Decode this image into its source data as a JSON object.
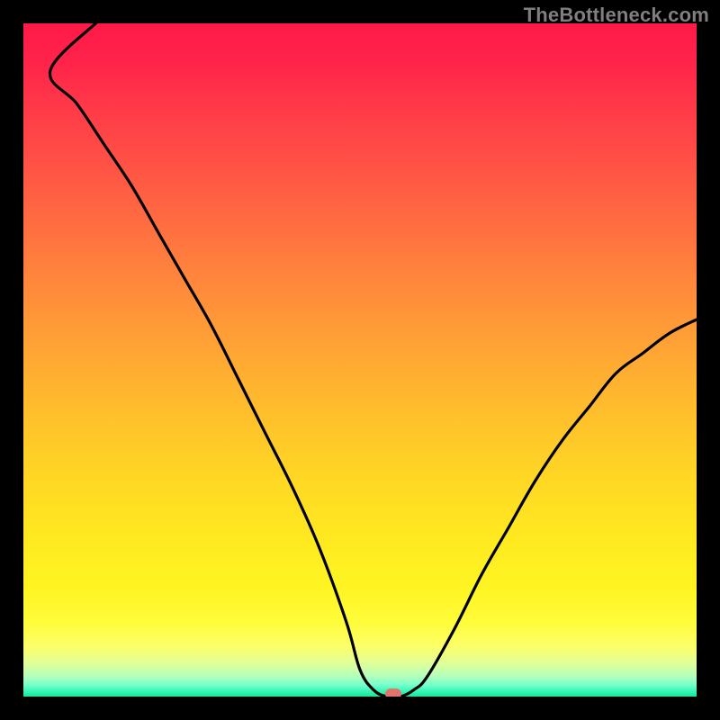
{
  "watermark": "TheBottleneck.com",
  "colors": {
    "background": "#000000",
    "curve": "#000000",
    "marker": "#e2746c",
    "watermark": "#7f7f7f"
  },
  "chart_data": {
    "type": "line",
    "title": "",
    "xlabel": "",
    "ylabel": "",
    "xlim": [
      0,
      100
    ],
    "ylim": [
      0,
      100
    ],
    "grid": false,
    "legend": false,
    "note": "Bottleneck-style plot. y≈0 at the minimum near x≈52–56; rises to ~100 toward the left edge and ~55 toward the right edge. Background is a vertical green→red gradient (green at bottom / low values, red at top / high values).",
    "series": [
      {
        "name": "bottleneck",
        "x": [
          0,
          4,
          8,
          12,
          16,
          20,
          24,
          28,
          32,
          36,
          40,
          44,
          48,
          50,
          52,
          54,
          56,
          58,
          60,
          64,
          68,
          72,
          76,
          80,
          84,
          88,
          92,
          96,
          100
        ],
        "y": [
          98,
          93,
          88,
          82,
          76,
          69,
          62,
          55,
          47,
          39,
          31,
          22,
          11,
          4,
          1,
          0,
          0,
          1,
          3,
          10,
          18,
          25,
          32,
          38,
          43,
          48,
          51,
          54,
          56
        ]
      }
    ],
    "marker": {
      "x": 55,
      "y": 0
    },
    "gradient_stops": [
      {
        "pct": 0,
        "color": "#ff1948"
      },
      {
        "pct": 50,
        "color": "#ffb030"
      },
      {
        "pct": 90,
        "color": "#fffd40"
      },
      {
        "pct": 100,
        "color": "#18e499"
      }
    ]
  }
}
